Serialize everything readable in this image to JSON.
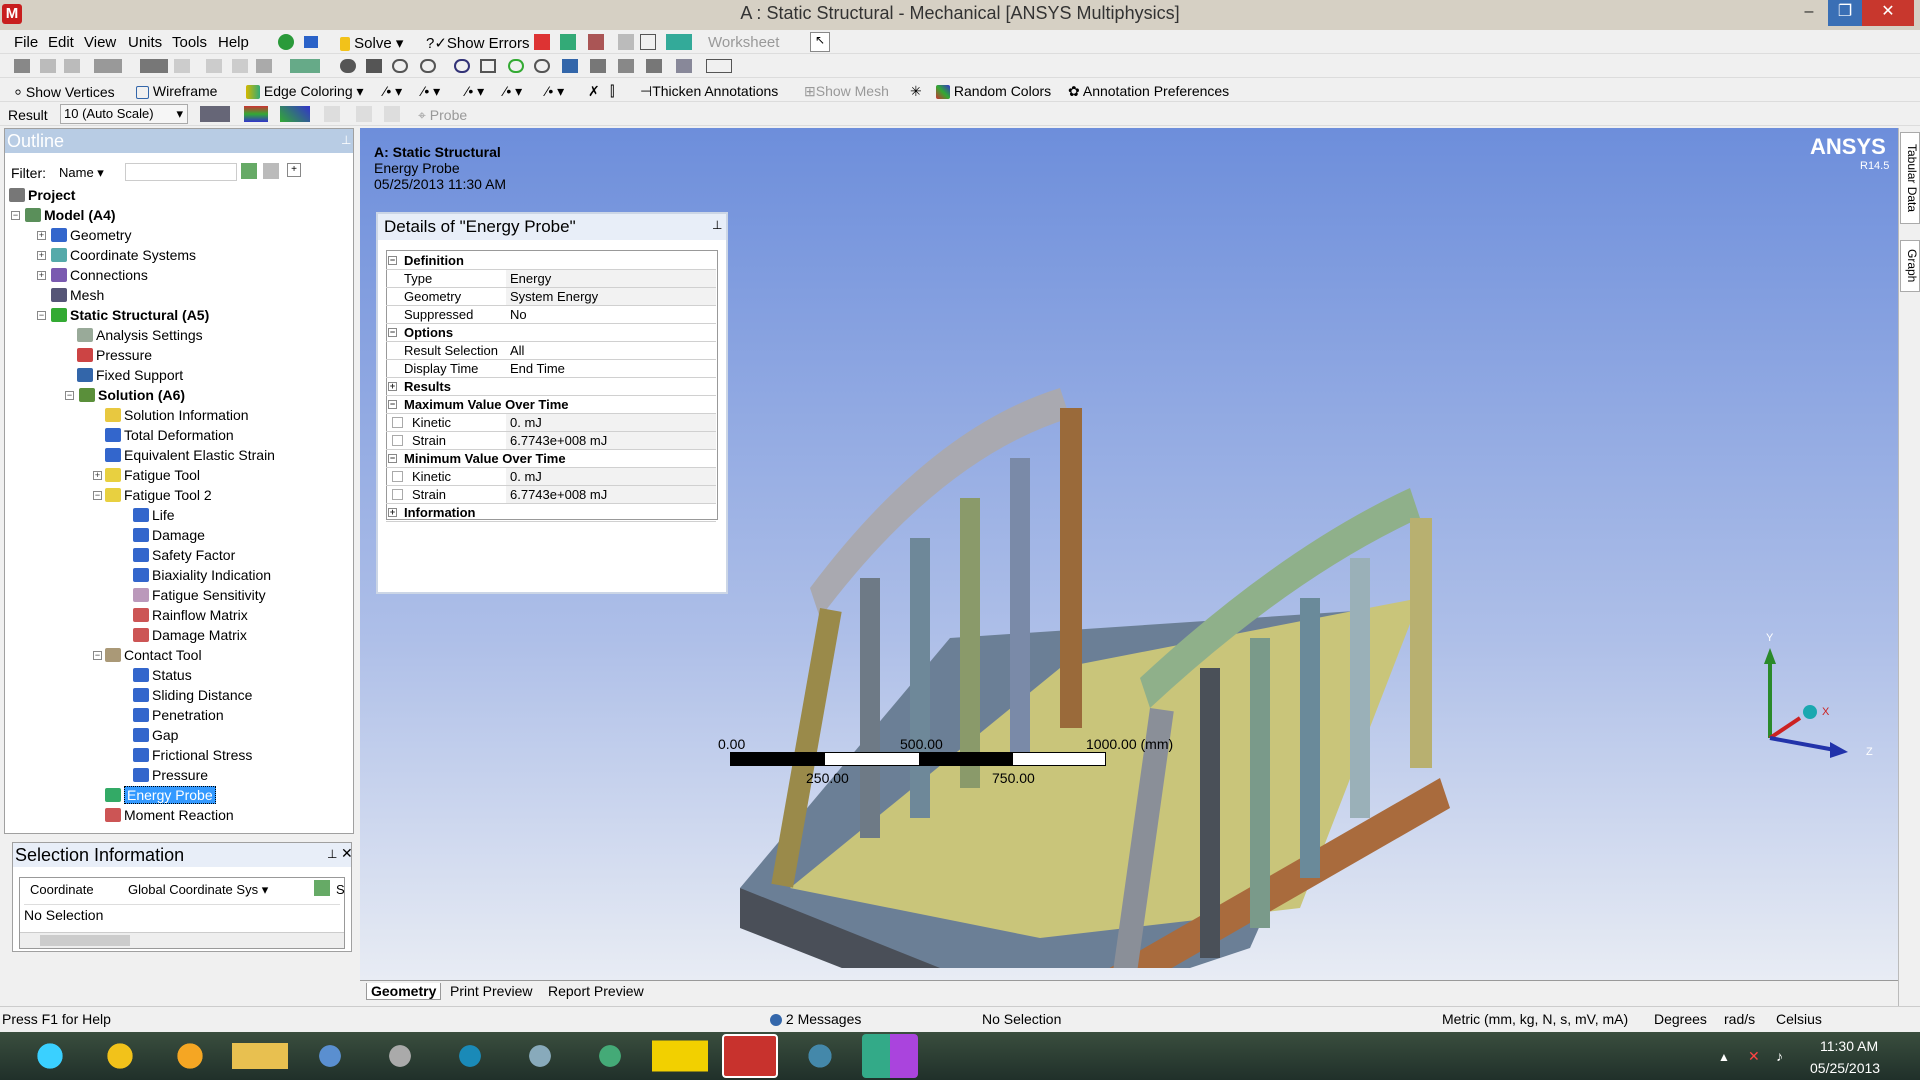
{
  "window": {
    "title": "A : Static Structural - Mechanical [ANSYS Multiphysics]",
    "app_icon_letter": "M"
  },
  "menubar": {
    "items": [
      "File",
      "Edit",
      "View",
      "Units",
      "Tools",
      "Help"
    ],
    "solve": "Solve",
    "show_errors": "Show Errors",
    "worksheet": "Worksheet"
  },
  "toolbar3": {
    "show_vertices": "Show Vertices",
    "wireframe": "Wireframe",
    "edge_coloring": "Edge Coloring",
    "thicken": "Thicken Annotations",
    "show_mesh": "Show Mesh",
    "random_colors": "Random Colors",
    "annotation_prefs": "Annotation Preferences"
  },
  "toolbar4": {
    "result_label": "Result",
    "result_value": "10 (Auto Scale)",
    "probe": "Probe"
  },
  "outline": {
    "title": "Outline",
    "filter_label": "Filter:",
    "filter_value": "Name",
    "items": [
      {
        "label": "Project"
      },
      {
        "label": "Model (A4)"
      },
      {
        "label": "Geometry"
      },
      {
        "label": "Coordinate Systems"
      },
      {
        "label": "Connections"
      },
      {
        "label": "Mesh"
      },
      {
        "label": "Static Structural (A5)"
      },
      {
        "label": "Analysis Settings"
      },
      {
        "label": "Pressure"
      },
      {
        "label": "Fixed Support"
      },
      {
        "label": "Solution (A6)"
      },
      {
        "label": "Solution Information"
      },
      {
        "label": "Total Deformation"
      },
      {
        "label": "Equivalent Elastic Strain"
      },
      {
        "label": "Fatigue Tool"
      },
      {
        "label": "Fatigue Tool 2"
      },
      {
        "label": "Life"
      },
      {
        "label": "Damage"
      },
      {
        "label": "Safety Factor"
      },
      {
        "label": "Biaxiality Indication"
      },
      {
        "label": "Fatigue Sensitivity"
      },
      {
        "label": "Rainflow Matrix"
      },
      {
        "label": "Damage Matrix"
      },
      {
        "label": "Contact Tool"
      },
      {
        "label": "Status"
      },
      {
        "label": "Sliding Distance"
      },
      {
        "label": "Penetration"
      },
      {
        "label": "Gap"
      },
      {
        "label": "Frictional Stress"
      },
      {
        "label": "Pressure"
      },
      {
        "label": "Energy Probe"
      },
      {
        "label": "Moment Reaction"
      }
    ]
  },
  "selection_info": {
    "title": "Selection Information",
    "coordinate_label": "Coordinate",
    "coordinate_value": "Global Coordinate Sys",
    "no_selection": "No Selection",
    "col_s": "S"
  },
  "viewport": {
    "header_title": "A: Static Structural",
    "header_sub": "Energy Probe",
    "header_date": "05/25/2013 11:30 AM",
    "logo": "ANSYS",
    "version": "R14.5",
    "scale": {
      "l0": "0.00",
      "l500": "500.00",
      "l1000": "1000.00 (mm)",
      "l250": "250.00",
      "l750": "750.00"
    },
    "axes": {
      "y": "Y",
      "x": "X",
      "z": "Z"
    }
  },
  "details": {
    "title": "Details of \"Energy Probe\"",
    "definition": "Definition",
    "type_l": "Type",
    "type_v": "Energy",
    "geom_l": "Geometry",
    "geom_v": "System Energy",
    "supp_l": "Suppressed",
    "supp_v": "No",
    "options": "Options",
    "rs_l": "Result Selection",
    "rs_v": "All",
    "dt_l": "Display Time",
    "dt_v": "End Time",
    "results": "Results",
    "max": "Maximum Value Over Time",
    "kin_l": "Kinetic",
    "kin_v": "0. mJ",
    "str_l": "Strain",
    "str_v": "6.7743e+008 mJ",
    "min": "Minimum Value Over Time",
    "information": "Information"
  },
  "tabs": [
    "Geometry",
    "Print Preview",
    "Report Preview"
  ],
  "right_tabs": [
    "Tabular Data",
    "Graph"
  ],
  "status": {
    "help": "Press F1 for Help",
    "messages": "2 Messages",
    "selection": "No Selection",
    "units": "Metric (mm, kg, N, s, mV, mA)",
    "degrees": "Degrees",
    "rads": "rad/s",
    "temp": "Celsius"
  },
  "clock": {
    "time": "11:30 AM",
    "date": "05/25/2013"
  }
}
